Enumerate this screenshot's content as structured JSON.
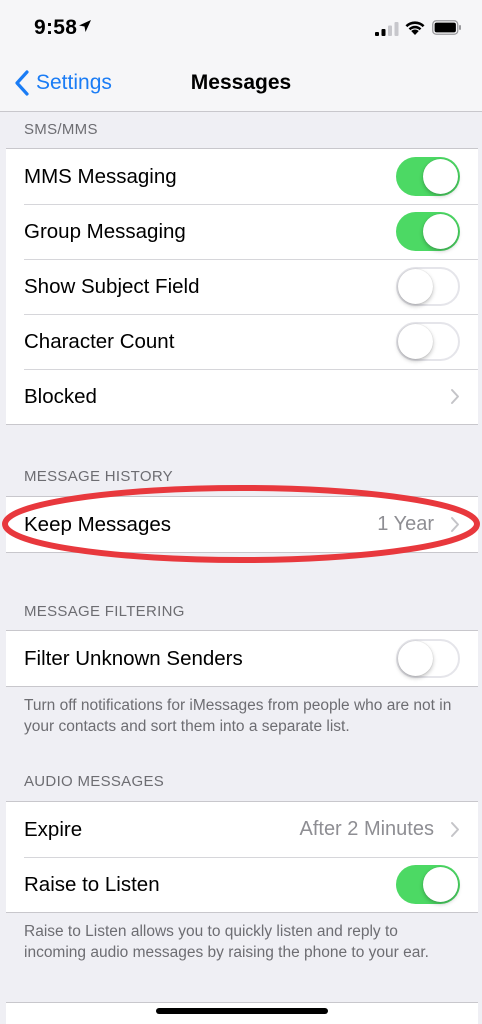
{
  "status_bar": {
    "time": "9:58",
    "icons": [
      "location-arrow-icon",
      "signal-icon",
      "wifi-icon",
      "battery-icon"
    ]
  },
  "nav": {
    "back_label": "Settings",
    "title": "Messages"
  },
  "colors": {
    "accent": "#1a7cf5",
    "toggle_on": "#4cd964",
    "highlight_oval": "#e8383d",
    "background": "#efeff4"
  },
  "sms_mms": {
    "header": "SMS/MMS",
    "rows": [
      {
        "label": "MMS Messaging",
        "toggle": true
      },
      {
        "label": "Group Messaging",
        "toggle": true
      },
      {
        "label": "Show Subject Field",
        "toggle": false
      },
      {
        "label": "Character Count",
        "toggle": false
      },
      {
        "label": "Blocked"
      }
    ]
  },
  "message_history": {
    "header": "MESSAGE HISTORY",
    "keep_messages": {
      "label": "Keep Messages",
      "value": "1 Year"
    }
  },
  "message_filtering": {
    "header": "MESSAGE FILTERING",
    "filter_unknown": {
      "label": "Filter Unknown Senders",
      "toggle": false
    },
    "footer": "Turn off notifications for iMessages from people who are not in your contacts and sort them into a separate list."
  },
  "audio_messages": {
    "header": "AUDIO MESSAGES",
    "expire": {
      "label": "Expire",
      "value": "After 2 Minutes"
    },
    "raise_to_listen": {
      "label": "Raise to Listen",
      "toggle": true
    },
    "footer": "Raise to Listen allows you to quickly listen and reply to incoming audio messages by raising the phone to your ear."
  }
}
